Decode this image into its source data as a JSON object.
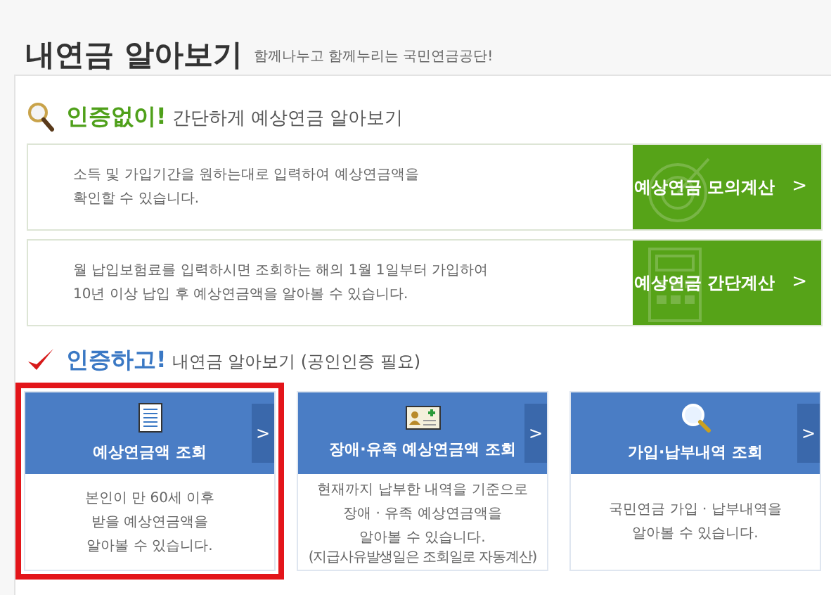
{
  "page": {
    "title": "내연금 알아보기",
    "slogan": "함께나누고 함께누리는 국민연금공단!"
  },
  "section_no_auth": {
    "highlight": "인증없이!",
    "heading": "간단하게 예상연금 알아보기",
    "rows": [
      {
        "kind": "target",
        "description": "소득 및 가입기간을 원하는대로 입력하여 예상연금액을\n확인할 수 있습니다.",
        "button": "예상연금 모의계산",
        "chevron": ">"
      },
      {
        "kind": "calculator",
        "description": "월 납입보험료를 입력하시면 조회하는 해의 1월 1일부터 가입하여\n10년 이상 납입 후 예상연금액을 알아볼 수 있습니다.",
        "button": "예상연금 간단계산",
        "chevron": ">"
      }
    ]
  },
  "section_auth": {
    "highlight": "인증하고!",
    "heading": "내연금 알아보기 (공인인증 필요)",
    "cards": [
      {
        "kind": "document",
        "title": "예상연금액 조회",
        "chevron": ">",
        "description": "본인이 만 60세 이후\n받을 예상연금액을\n알아볼 수 있습니다.",
        "highlighted": true
      },
      {
        "kind": "id-card",
        "title": "장애·유족 예상연금액 조회",
        "chevron": ">",
        "description": "현재까지 납부한 내역을 기준으로\n장애 · 유족 예상연금액을\n알아볼 수 있습니다.",
        "note": "(지급사유발생일은 조회일로 자동계산)",
        "highlighted": false
      },
      {
        "kind": "magnifier",
        "title": "가입·납부내역 조회",
        "chevron": ">",
        "description": "국민연금 가입 · 납부내역을\n알아볼 수 있습니다.",
        "highlighted": false
      }
    ]
  }
}
